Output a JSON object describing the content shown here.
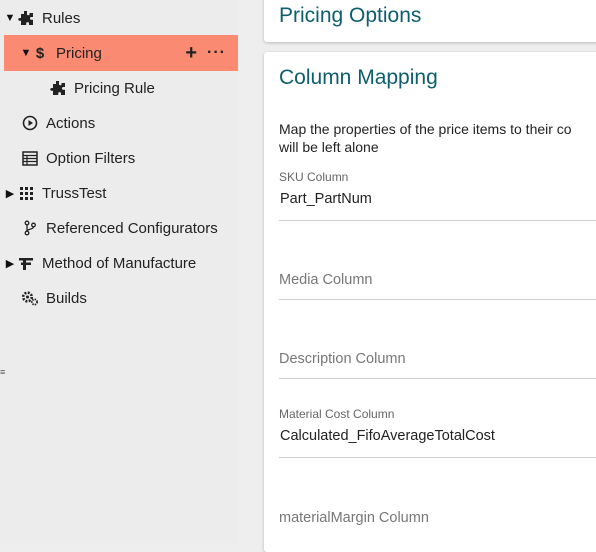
{
  "sidebar": {
    "items": [
      {
        "label": "Rules",
        "toggle": "▼"
      },
      {
        "label": "Pricing",
        "toggle": "▼"
      },
      {
        "label": "Pricing Rule",
        "toggle": ""
      },
      {
        "label": "Actions",
        "toggle": ""
      },
      {
        "label": "Option Filters",
        "toggle": ""
      },
      {
        "label": "TrussTest",
        "toggle": "▶"
      },
      {
        "label": "Referenced Configurators",
        "toggle": ""
      },
      {
        "label": "Method of Manufacture",
        "toggle": "▶"
      },
      {
        "label": "Builds",
        "toggle": ""
      }
    ],
    "add_label": "+",
    "more_label": "···",
    "edge_handle": "≡"
  },
  "header_card": {
    "title": "Pricing Options"
  },
  "mapping": {
    "title": "Column Mapping",
    "description": "Map the properties of the price items to their co\nwill be left alone",
    "fields": [
      {
        "label": "SKU Column",
        "value": "Part_PartNum",
        "placeholder": ""
      },
      {
        "label": "",
        "value": "",
        "placeholder": "Media Column"
      },
      {
        "label": "",
        "value": "",
        "placeholder": "Description Column"
      },
      {
        "label": "Material Cost Column",
        "value": "Calculated_FifoAverageTotalCost",
        "placeholder": ""
      },
      {
        "label": "",
        "value": "",
        "placeholder": "materialMargin Column"
      }
    ]
  },
  "colors": {
    "selected_bg": "#fa8a72",
    "title_teal": "#0d5e6e",
    "sidebar_bg": "#ececec"
  }
}
